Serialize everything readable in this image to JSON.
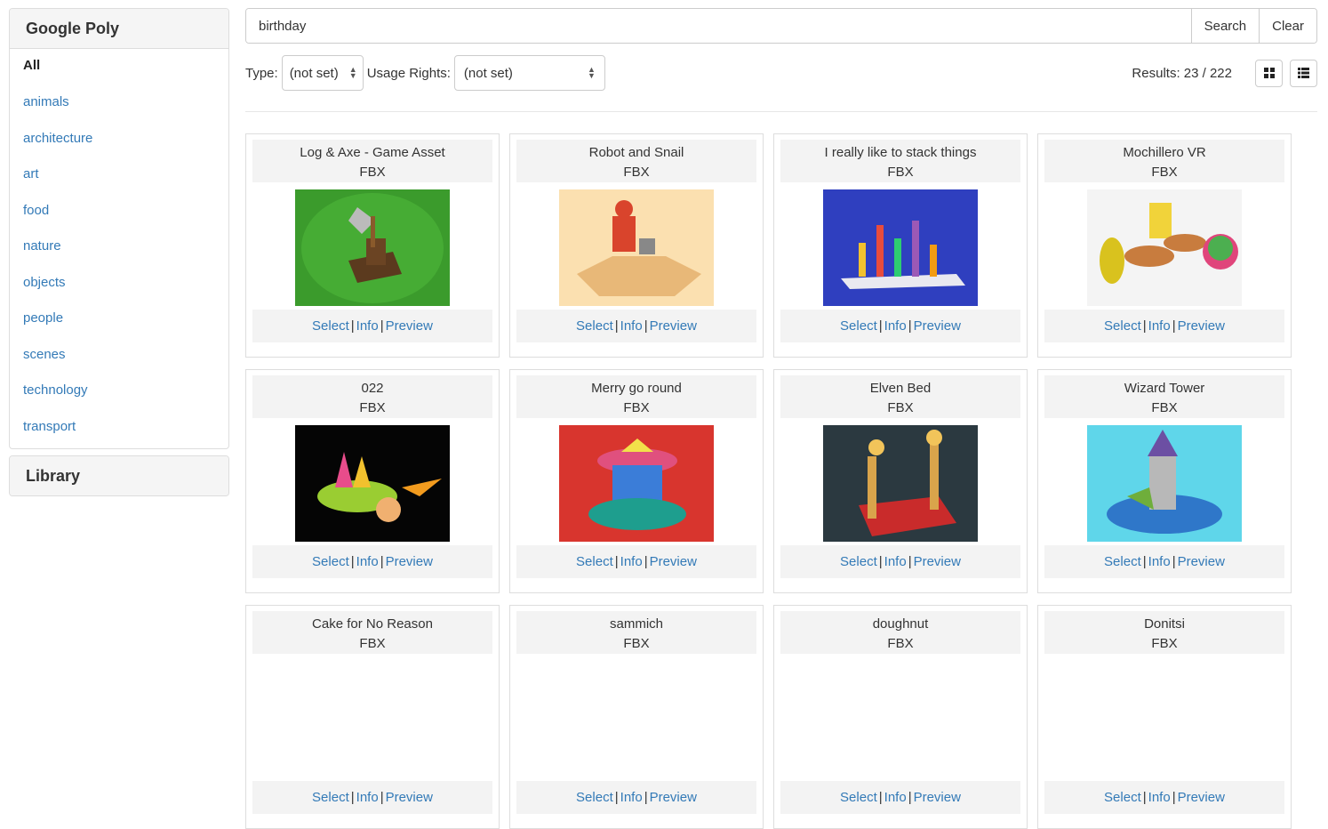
{
  "sidebar": {
    "panel_title": "Google Poly",
    "categories": [
      {
        "label": "All",
        "active": true
      },
      {
        "label": "animals"
      },
      {
        "label": "architecture"
      },
      {
        "label": "art"
      },
      {
        "label": "food"
      },
      {
        "label": "nature"
      },
      {
        "label": "objects"
      },
      {
        "label": "people"
      },
      {
        "label": "scenes"
      },
      {
        "label": "technology"
      },
      {
        "label": "transport"
      }
    ],
    "library_title": "Library"
  },
  "search": {
    "value": "birthday",
    "search_label": "Search",
    "clear_label": "Clear"
  },
  "filters": {
    "type_label": "Type:",
    "type_value": "(not set)",
    "rights_label": "Usage Rights:",
    "rights_value": "(not set)",
    "results": "Results: 23 / 222"
  },
  "card_links": {
    "select": "Select",
    "info": "Info",
    "preview": "Preview",
    "separator": "|"
  },
  "assets": [
    {
      "title": "Log & Axe - Game Asset",
      "format": "FBX",
      "thumb": "log-axe"
    },
    {
      "title": "Robot and Snail",
      "format": "FBX",
      "thumb": "robot-snail"
    },
    {
      "title": "I really like to stack things",
      "format": "FBX",
      "thumb": "stack"
    },
    {
      "title": "Mochillero VR",
      "format": "FBX",
      "thumb": "mochillero"
    },
    {
      "title": "022",
      "format": "FBX",
      "thumb": "022"
    },
    {
      "title": "Merry go round",
      "format": "FBX",
      "thumb": "merry"
    },
    {
      "title": "Elven Bed",
      "format": "FBX",
      "thumb": "elven-bed"
    },
    {
      "title": "Wizard Tower",
      "format": "FBX",
      "thumb": "wizard"
    },
    {
      "title": "Cake for No Reason",
      "format": "FBX",
      "thumb": "cake"
    },
    {
      "title": "sammich",
      "format": "FBX",
      "thumb": "sammich"
    },
    {
      "title": "doughnut",
      "format": "FBX",
      "thumb": "doughnut"
    },
    {
      "title": "Donitsi",
      "format": "FBX",
      "thumb": "donitsi"
    }
  ]
}
